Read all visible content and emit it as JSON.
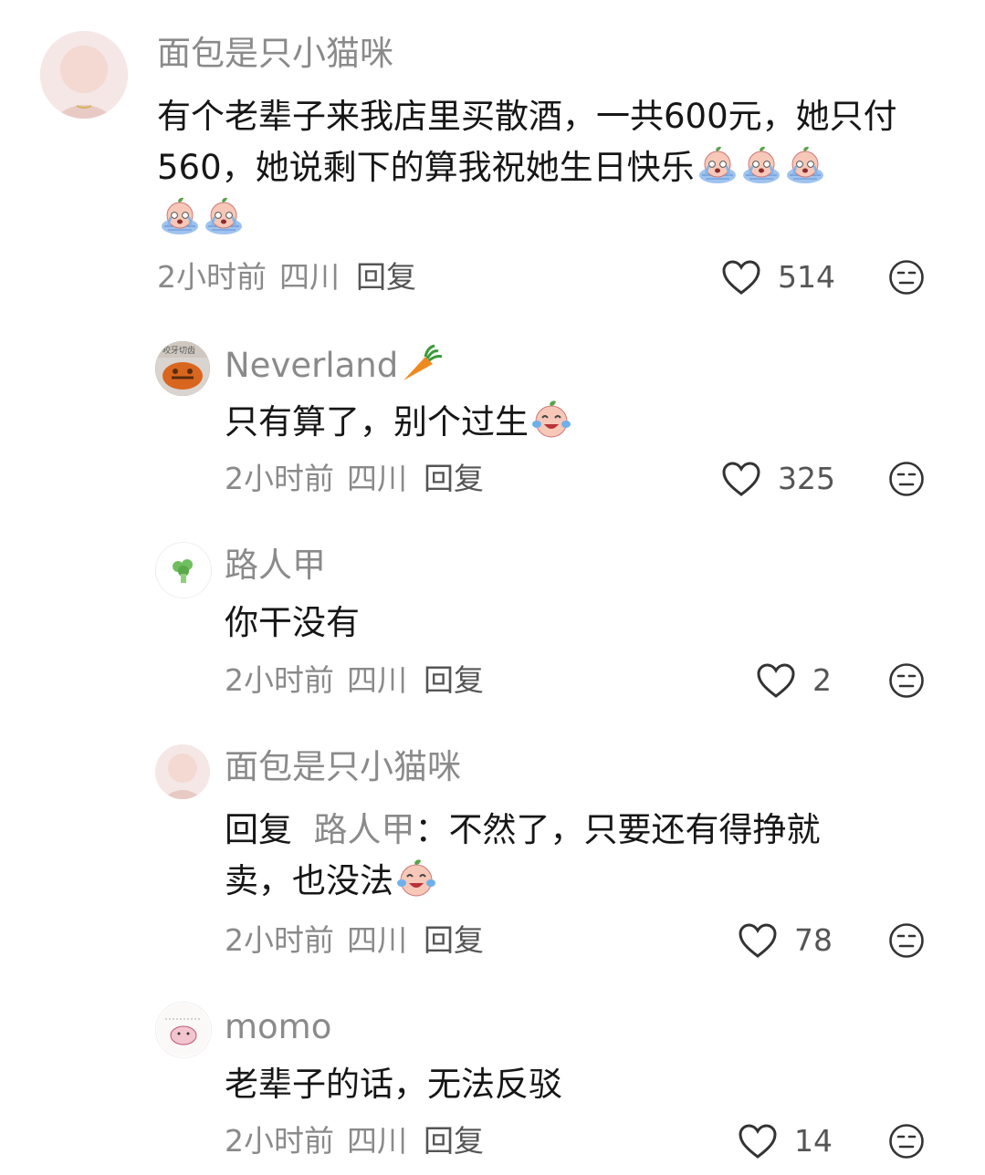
{
  "comments": [
    {
      "name": "面包是只小猫咪",
      "text": "有个老辈子来我店里买散酒，一共600元，她只付560，她说剩下的算我祝她生日快乐",
      "time": "2小时前",
      "location": "四川",
      "reply": "回复",
      "likes": "514"
    },
    {
      "name": "Neverland",
      "text": "只有算了，别个过生",
      "time": "2小时前",
      "location": "四川",
      "reply": "回复",
      "likes": "325"
    },
    {
      "name": "路人甲",
      "text": "你干没有",
      "time": "2小时前",
      "location": "四川",
      "reply": "回复",
      "likes": "2"
    },
    {
      "name": "面包是只小猫咪",
      "reply_prefix": "回复",
      "reply_to": "路人甲",
      "reply_colon": "：",
      "text_line1": "不然了，只要还有得挣就",
      "text_line2": "卖，也没法",
      "time": "2小时前",
      "location": "四川",
      "reply": "回复",
      "likes": "78"
    },
    {
      "name": "momo",
      "text": "老辈子的话，无法反驳",
      "time": "2小时前",
      "location": "四川",
      "reply": "回复",
      "likes": "14"
    }
  ],
  "avatar_texts": {
    "neverland": "咬牙切齿"
  }
}
